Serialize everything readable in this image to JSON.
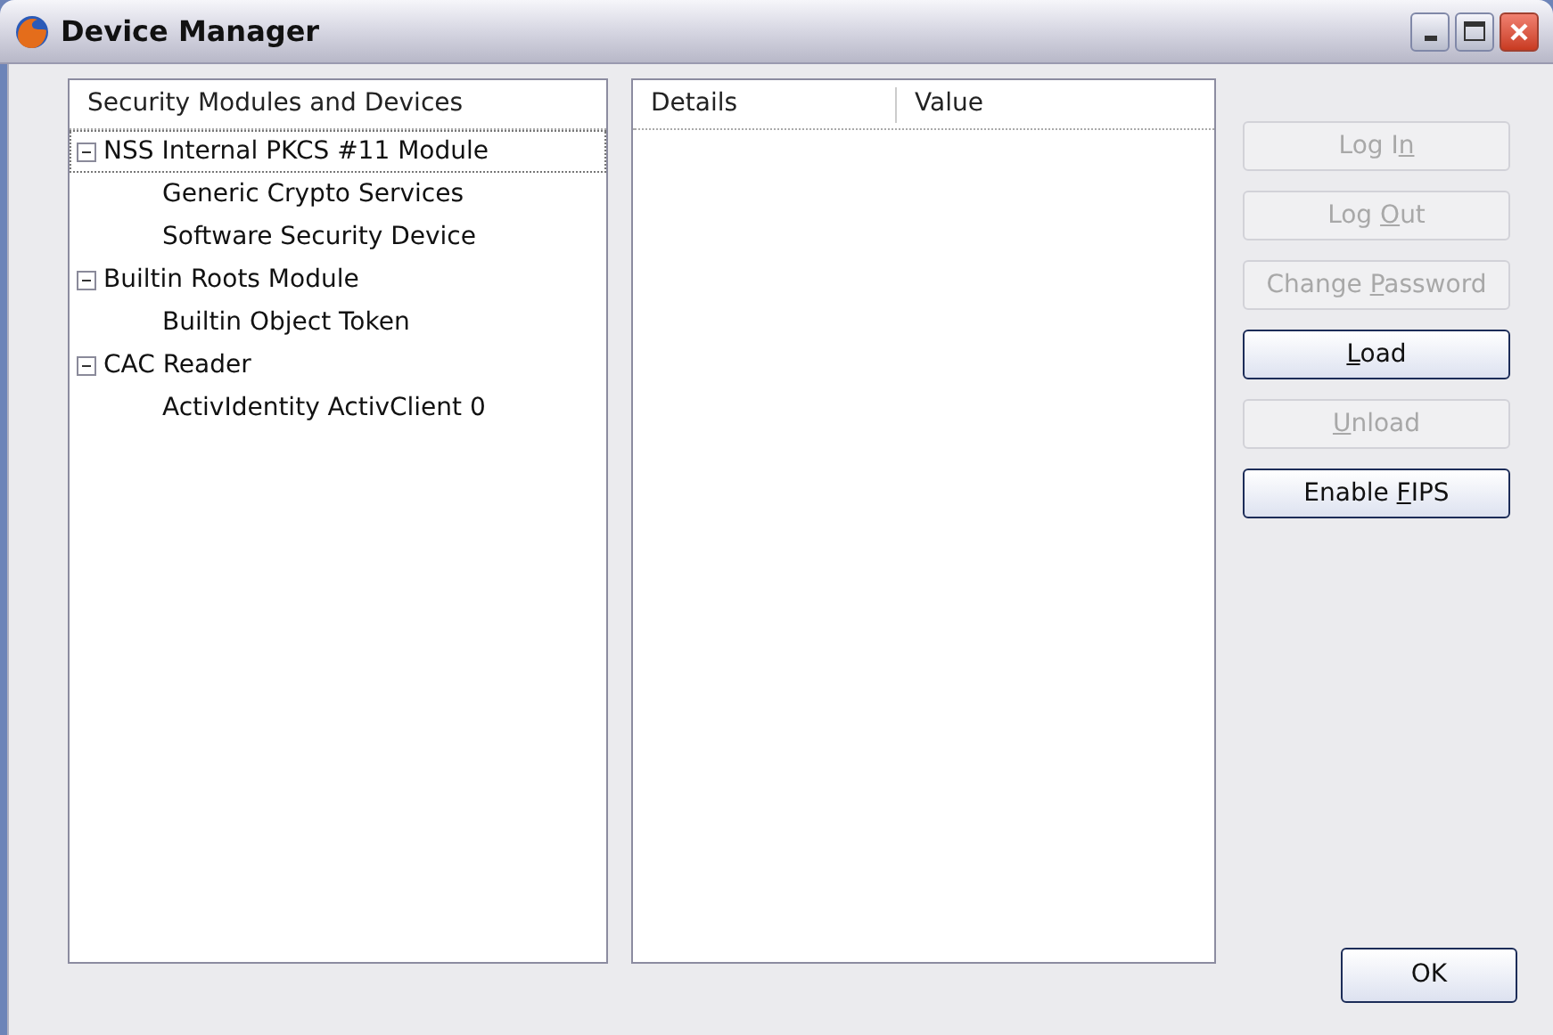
{
  "window": {
    "title": "Device Manager"
  },
  "tree": {
    "columns": [
      "Security Modules and Devices"
    ],
    "items": [
      {
        "label": "NSS Internal PKCS #11 Module",
        "expanded": true,
        "focused": true,
        "children": [
          {
            "label": "Generic Crypto Services",
            "focused": false
          },
          {
            "label": "Software Security Device",
            "focused": false
          }
        ]
      },
      {
        "label": "Builtin Roots Module",
        "expanded": true,
        "focused": false,
        "children": [
          {
            "label": "Builtin Object Token",
            "focused": false
          }
        ]
      },
      {
        "label": "CAC Reader",
        "expanded": true,
        "focused": false,
        "children": [
          {
            "label": "ActivIdentity ActivClient 0",
            "focused": false
          }
        ]
      }
    ]
  },
  "details": {
    "columns": [
      "Details",
      "Value"
    ]
  },
  "buttons": [
    {
      "segments": [
        {
          "text": "Log I",
          "underlined": false
        },
        {
          "text": "n",
          "underlined": true
        }
      ],
      "disabled": true
    },
    {
      "segments": [
        {
          "text": "Log ",
          "underlined": false
        },
        {
          "text": "O",
          "underlined": true
        },
        {
          "text": "ut",
          "underlined": false
        }
      ],
      "disabled": true
    },
    {
      "segments": [
        {
          "text": "Change ",
          "underlined": false
        },
        {
          "text": "P",
          "underlined": true
        },
        {
          "text": "assword",
          "underlined": false
        }
      ],
      "disabled": true
    },
    {
      "segments": [
        {
          "text": "L",
          "underlined": true
        },
        {
          "text": "oad",
          "underlined": false
        }
      ],
      "disabled": false
    },
    {
      "segments": [
        {
          "text": "U",
          "underlined": true
        },
        {
          "text": "nload",
          "underlined": false
        }
      ],
      "disabled": true
    },
    {
      "segments": [
        {
          "text": "Enable ",
          "underlined": false
        },
        {
          "text": "F",
          "underlined": true
        },
        {
          "text": "IPS",
          "underlined": false
        }
      ],
      "disabled": false
    }
  ],
  "ok_button": {
    "label": "OK"
  }
}
